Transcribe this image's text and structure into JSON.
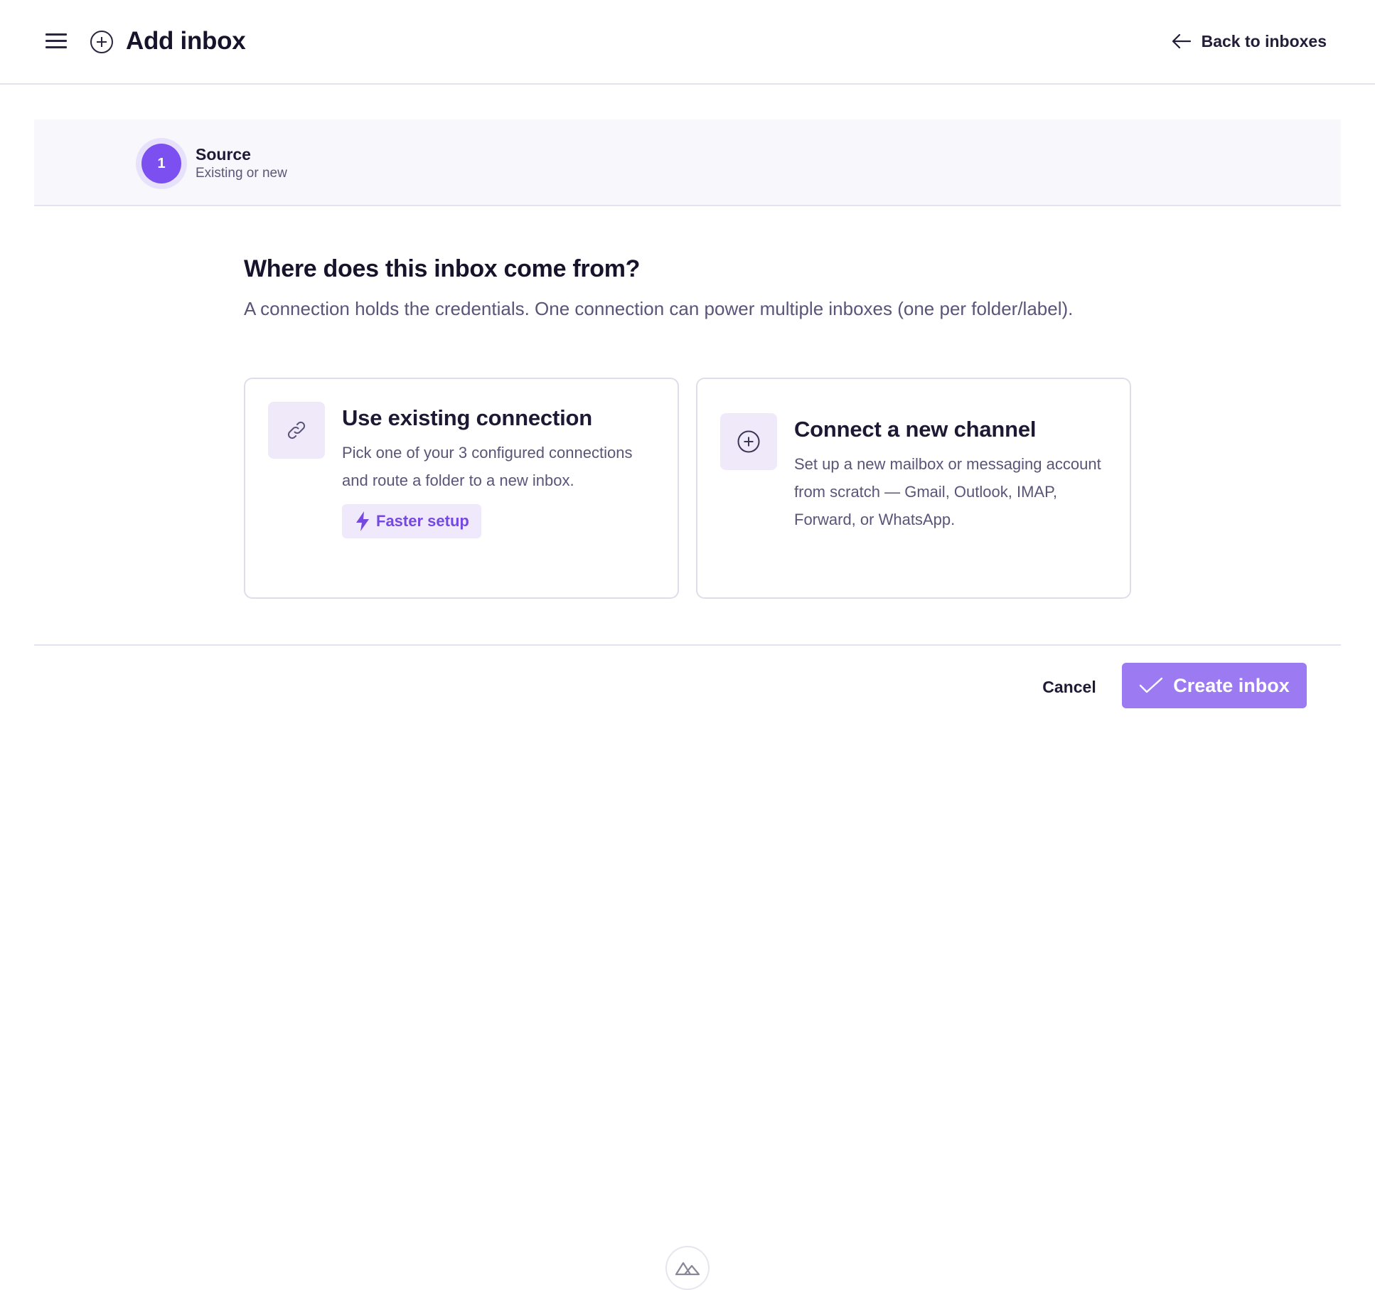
{
  "header": {
    "title": "Add inbox",
    "back_label": "Back to inboxes",
    "icons": {
      "menu": "hamburger-menu-icon",
      "add": "plus-circle-icon",
      "back": "arrow-left-icon"
    }
  },
  "stepper": {
    "steps": [
      {
        "number": "1",
        "title": "Source",
        "subtitle": "Existing or new",
        "state": "active"
      }
    ]
  },
  "main": {
    "question": "Where does this inbox come from?",
    "description": "A connection holds the credentials. One connection can power multiple inboxes (one per folder/label).",
    "options": [
      {
        "title": "Use existing connection",
        "text": "Pick one of your 3 configured connections and route a folder to a new inbox.",
        "badge": "Faster setup",
        "icon": "link-icon",
        "badge_icon": "lightning-icon"
      },
      {
        "title": "Connect a new channel",
        "text": "Set up a new mailbox or messaging account from scratch — Gmail, Outlook, IMAP, Forward, or WhatsApp.",
        "icon": "plus-circle-icon"
      }
    ]
  },
  "footer": {
    "cancel_label": "Cancel",
    "create_label": "Create inbox",
    "create_icon": "check-icon"
  },
  "colors": {
    "accent": "#7c4ff0",
    "accent_disabled": "#9c7bf2",
    "badge_bg": "#efe9fb",
    "text_primary": "#17132b",
    "text_muted": "#5a5478",
    "border": "#e0ddea"
  }
}
